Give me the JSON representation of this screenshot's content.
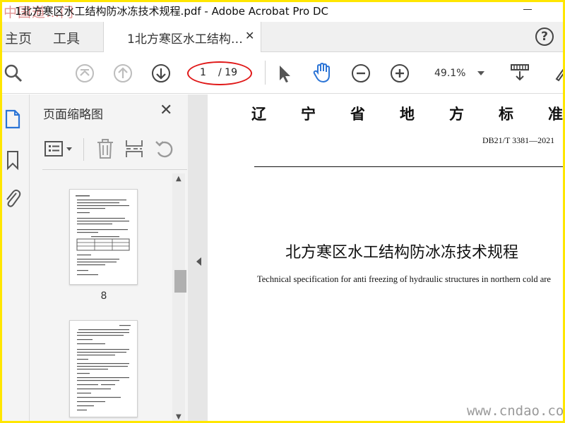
{
  "window": {
    "title": "1北方寒区水工结构防冰冻技术规程.pdf - Adobe Acrobat Pro DC",
    "overlay_logo_text": "中国道…门"
  },
  "tabs": {
    "home": "主页",
    "tools": "工具",
    "document": "1北方寒区水工结构…",
    "close": "✕",
    "help": "?"
  },
  "toolbar": {
    "page_current": "1",
    "page_total": "/ 19",
    "zoom": "49.1%"
  },
  "panel": {
    "title": "页面缩略图",
    "close": "✕",
    "thumbnails": [
      {
        "label": "8"
      },
      {
        "label": ""
      }
    ]
  },
  "document": {
    "header": "辽宁省地方标准",
    "code": "DB21/T  3381—2021",
    "title": "北方寒区水工结构防冰冻技术规程",
    "subtitle_en": "Technical specification for anti freezing of hydraulic structures in northern cold are"
  },
  "watermark": "www.cndao.com",
  "colors": {
    "accent_blue": "#2b74d6",
    "annotation_red": "#e01818",
    "frame_yellow": "#ffe600"
  }
}
